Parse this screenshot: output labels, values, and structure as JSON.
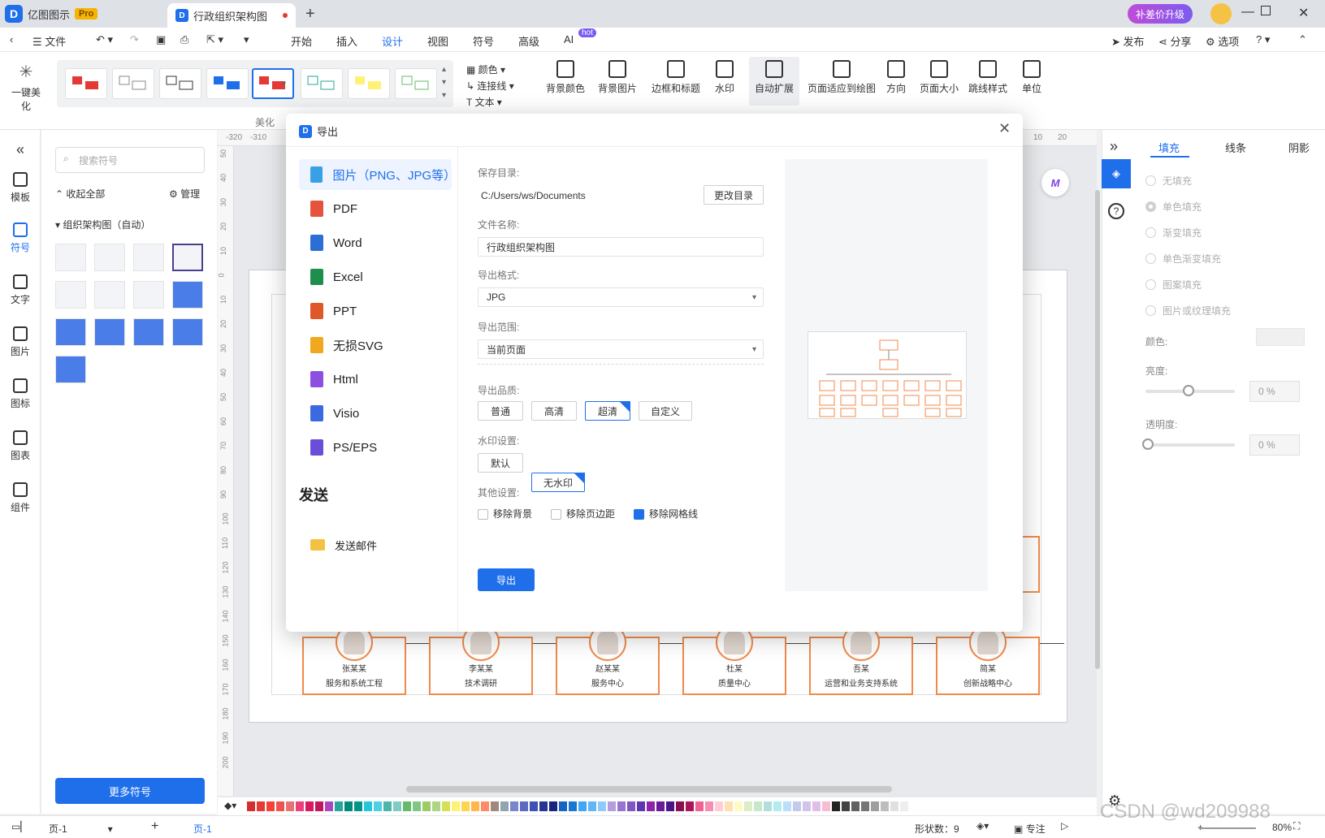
{
  "app": {
    "name": "亿图图示",
    "badge": "Pro"
  },
  "tab": {
    "title": "行政组织架构图"
  },
  "topright": {
    "upgrade": "补差价升级"
  },
  "menu": {
    "file": "文件",
    "items": [
      "开始",
      "插入",
      "设计",
      "视图",
      "符号",
      "高级",
      "AI"
    ],
    "ai_badge": "hot",
    "publish": "发布",
    "share": "分享",
    "options": "选项"
  },
  "ribbon": {
    "beautify": "一键美化",
    "group_label": "美化",
    "color": "颜色",
    "connector": "连接线",
    "text": "文本",
    "buttons": [
      "背景颜色",
      "背景图片",
      "边框和标题",
      "水印",
      "自动扩展",
      "页面适应到绘图",
      "方向",
      "页面大小",
      "跳线样式",
      "单位"
    ]
  },
  "leftbar": {
    "items": [
      "模板",
      "符号",
      "文字",
      "图片",
      "图标",
      "图表",
      "组件"
    ]
  },
  "sympanel": {
    "search_placeholder": "搜索符号",
    "collapse": "收起全部",
    "manage": "管理",
    "category": "组织架构图（自动）",
    "more": "更多符号"
  },
  "ruler": {
    "top": [
      "-320",
      "-310",
      "10",
      "20"
    ],
    "left": [
      "50",
      "40",
      "30",
      "20",
      "10",
      "0",
      "10",
      "20",
      "30",
      "40",
      "50",
      "60",
      "70",
      "80",
      "90",
      "100",
      "110",
      "120",
      "130",
      "140",
      "150",
      "160",
      "170",
      "180",
      "190",
      "200"
    ]
  },
  "org": {
    "nodes": [
      {
        "name": "张某某",
        "dept": "服务和系统工程"
      },
      {
        "name": "李某某",
        "dept": "技术调研"
      },
      {
        "name": "赵某某",
        "dept": "服务中心"
      },
      {
        "name": "杜某",
        "dept": "质量中心"
      },
      {
        "name": "吾某",
        "dept": "运营和业务支持系统"
      },
      {
        "name": "简某",
        "dept": "创新战略中心"
      }
    ]
  },
  "rightpanel": {
    "tabs": [
      "填充",
      "线条",
      "阴影"
    ],
    "options": [
      "无填充",
      "单色填充",
      "渐变填充",
      "单色渐变填充",
      "图案填充",
      "图片或纹理填充"
    ],
    "color_label": "颜色:",
    "brightness_label": "亮度:",
    "brightness": "0 %",
    "transparency_label": "透明度:",
    "transparency": "0 %"
  },
  "status": {
    "page_select": "页-1",
    "page_tab": "页-1",
    "shapes": "形状数：9",
    "focus": "专注",
    "zoom": "80%"
  },
  "palette": [
    "#d32f2f",
    "#e53935",
    "#f44336",
    "#ef5350",
    "#e57373",
    "#ec407a",
    "#d81b60",
    "#c2185b",
    "#ab47bc",
    "#26a69a",
    "#00897b",
    "#009688",
    "#26c6da",
    "#4dd0e1",
    "#4db6ac",
    "#80cbc4",
    "#66bb6a",
    "#81c784",
    "#9ccc65",
    "#aed581",
    "#d4e157",
    "#fff176",
    "#ffd54f",
    "#ffb74d",
    "#ff8a65",
    "#a1887f",
    "#90a4ae",
    "#7986cb",
    "#5c6bc0",
    "#3f51b5",
    "#283593",
    "#1a237e",
    "#1565c0",
    "#1976d2",
    "#42a5f5",
    "#64b5f6",
    "#90caf9",
    "#b39ddb",
    "#9575cd",
    "#7e57c2",
    "#5e35b1",
    "#8e24aa",
    "#6a1b9a",
    "#4a148c",
    "#880e4f",
    "#ad1457",
    "#f06292",
    "#f48fb1",
    "#ffcdd2",
    "#ffe0b2",
    "#fff9c4",
    "#dcedc8",
    "#c8e6c9",
    "#b2dfdb",
    "#b2ebf2",
    "#bbdefb",
    "#c5cae9",
    "#d1c4e9",
    "#e1bee7",
    "#f8bbd0",
    "#212121",
    "#424242",
    "#616161",
    "#757575",
    "#9e9e9e",
    "#bdbdbd",
    "#e0e0e0",
    "#eeeeee"
  ],
  "dialog": {
    "title": "导出",
    "formats": [
      "图片（PNG、JPG等）",
      "PDF",
      "Word",
      "Excel",
      "PPT",
      "无损SVG",
      "Html",
      "Visio",
      "PS/EPS"
    ],
    "send_title": "发送",
    "send_mail": "发送邮件",
    "save_dir_label": "保存目录:",
    "save_dir": "C:/Users/ws/Documents",
    "change_dir": "更改目录",
    "filename_label": "文件名称:",
    "filename": "行政组织架构图",
    "format_label": "导出格式:",
    "format": "JPG",
    "range_label": "导出范围:",
    "range": "当前页面",
    "quality_label": "导出品质:",
    "quality": [
      "普通",
      "高清",
      "超清",
      "自定义"
    ],
    "watermark_label": "水印设置:",
    "watermark": [
      "默认",
      "无水印"
    ],
    "other_label": "其他设置:",
    "other": [
      "移除背景",
      "移除页边距",
      "移除网格线"
    ],
    "export": "导出"
  },
  "watermark_text": "CSDN @wd209988"
}
